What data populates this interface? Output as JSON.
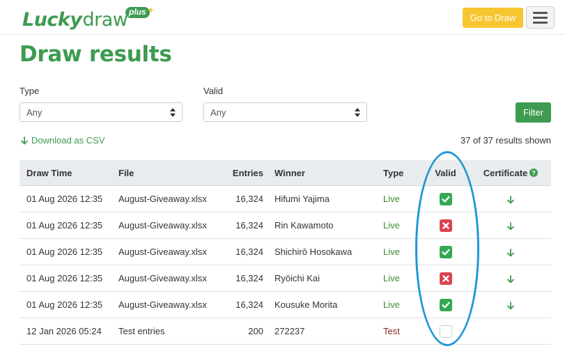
{
  "header": {
    "logo": {
      "lucky": "Lucky",
      "draw": "draw",
      "plus": "plus"
    },
    "goto_label": "Go to Draw",
    "menu_icon": "hamburger-menu-icon"
  },
  "page": {
    "title": "Draw results"
  },
  "filters": {
    "type_label": "Type",
    "type_value": "Any",
    "valid_label": "Valid",
    "valid_value": "Any",
    "filter_button": "Filter"
  },
  "csv_link": "Download as CSV",
  "results_count": "37 of 37 results shown",
  "table": {
    "headers": {
      "draw_time": "Draw Time",
      "file": "File",
      "entries": "Entries",
      "winner": "Winner",
      "type": "Type",
      "valid": "Valid",
      "certificate": "Certificate"
    },
    "rows": [
      {
        "draw_time": "01 Aug 2026 12:35",
        "file": "August-Giveaway.xlsx",
        "entries": "16,324",
        "winner": "Hifumi Yajima",
        "type": "Live",
        "valid": "valid",
        "certificate": true
      },
      {
        "draw_time": "01 Aug 2026 12:35",
        "file": "August-Giveaway.xlsx",
        "entries": "16,324",
        "winner": "Rin Kawamoto",
        "type": "Live",
        "valid": "invalid",
        "certificate": true
      },
      {
        "draw_time": "01 Aug 2026 12:35",
        "file": "August-Giveaway.xlsx",
        "entries": "16,324",
        "winner": "Shichirō Hosokawa",
        "type": "Live",
        "valid": "valid",
        "certificate": true
      },
      {
        "draw_time": "01 Aug 2026 12:35",
        "file": "August-Giveaway.xlsx",
        "entries": "16,324",
        "winner": "Ryōichi Kai",
        "type": "Live",
        "valid": "invalid",
        "certificate": true
      },
      {
        "draw_time": "01 Aug 2026 12:35",
        "file": "August-Giveaway.xlsx",
        "entries": "16,324",
        "winner": "Kousuke Morita",
        "type": "Live",
        "valid": "valid",
        "certificate": true
      },
      {
        "draw_time": "12 Jan 2026 05:24",
        "file": "Test entries",
        "entries": "200",
        "winner": "272237",
        "type": "Test",
        "valid": "none",
        "certificate": false
      }
    ]
  },
  "colors": {
    "brand_green": "#3e9b50",
    "accent_yellow": "#f7c631",
    "valid_green": "#34a853",
    "invalid_red": "#d9444f",
    "annotation_blue": "#1f97d6"
  }
}
